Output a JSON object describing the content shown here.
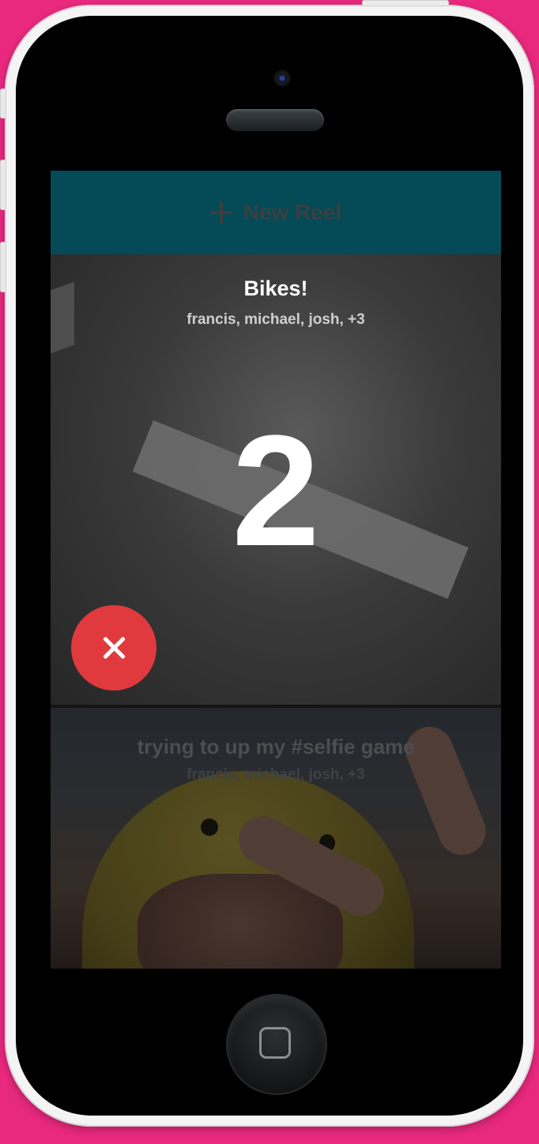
{
  "header": {
    "new_reel_label": "New Reel",
    "icon": "plus-icon"
  },
  "reels": [
    {
      "title": "Bikes!",
      "members": "francis, michael, josh, +3",
      "countdown": "2",
      "cancel_icon": "close-icon"
    },
    {
      "title": "trying to up my #selfie game",
      "members": "francis, michael, josh, +3"
    }
  ],
  "colors": {
    "background": "#e8297e",
    "header": "#044a57",
    "cancel_button": "#e03a3e"
  }
}
